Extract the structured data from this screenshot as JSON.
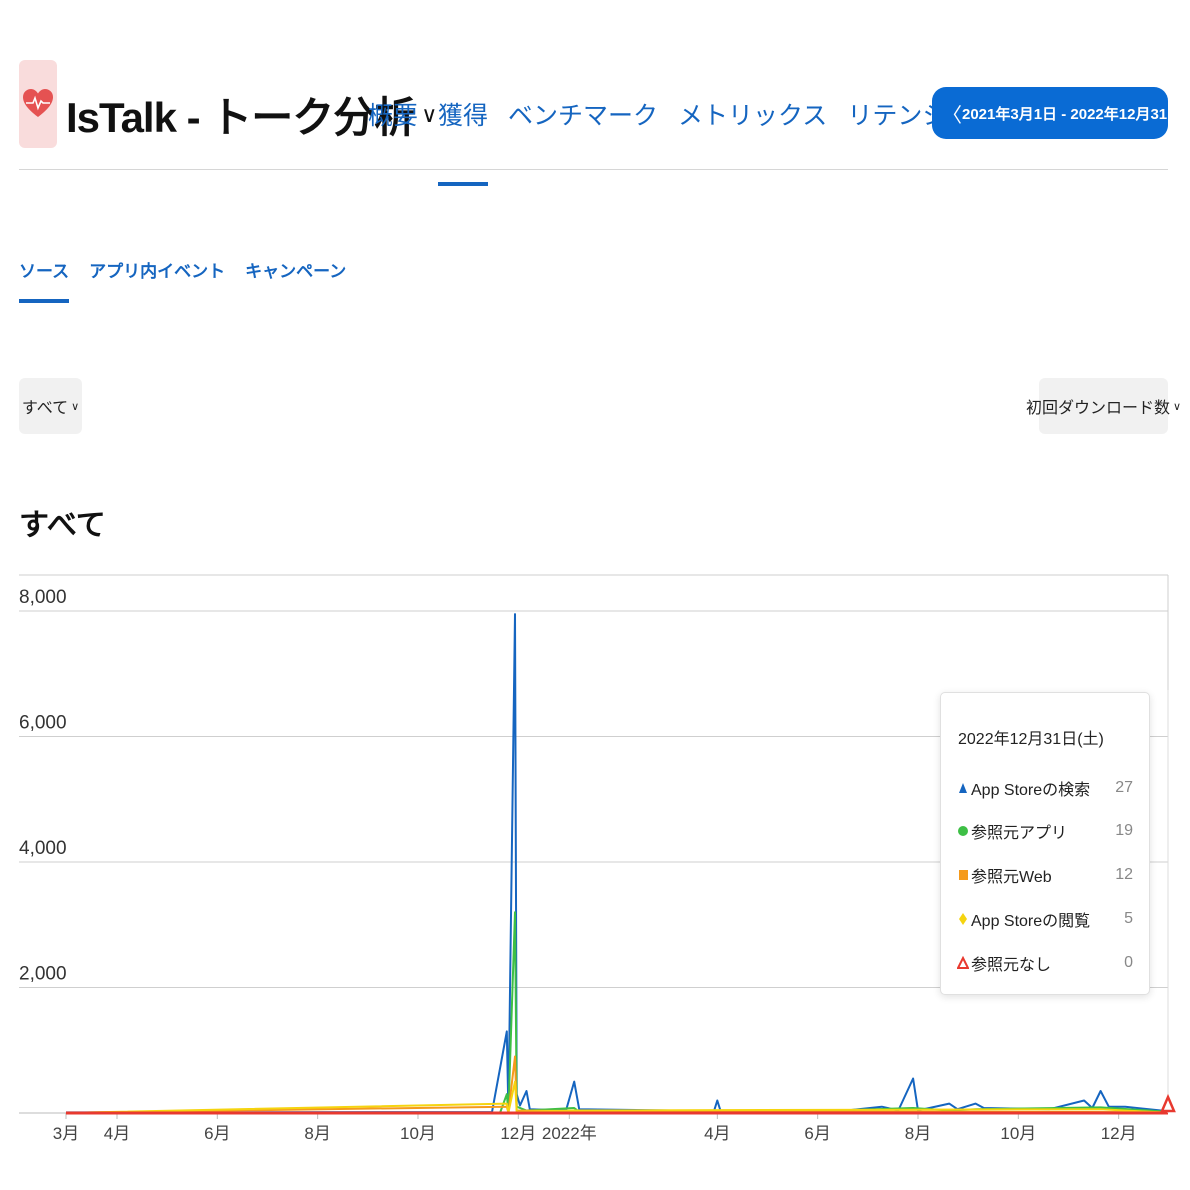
{
  "header": {
    "app_title": "IsTalk - トーク分析",
    "title_chevron": "∨",
    "tabs": [
      {
        "label": "概要",
        "active": false
      },
      {
        "label": "獲得",
        "active": true
      },
      {
        "label": "ベンチマーク",
        "active": false
      },
      {
        "label": "メトリックス",
        "active": false
      },
      {
        "label": "リテンション率",
        "active": false
      }
    ],
    "date_range": "2021年3月1日 - 2022年12月31日",
    "prev_arrow": "〈",
    "next_arrow": "〉"
  },
  "subtabs": [
    {
      "label": "ソース",
      "active": true
    },
    {
      "label": "アプリ内イベント",
      "active": false
    },
    {
      "label": "キャンペーン",
      "active": false
    }
  ],
  "filters": {
    "left_value": "すべて",
    "right_value": "初回ダウンロード数",
    "chevron": "∨"
  },
  "section_title": "すべて",
  "colors": {
    "accent": "#1565c0",
    "app_store_search": "#1565c0",
    "referral_app": "#3dbf45",
    "referral_web": "#f59a1b",
    "app_store_browse": "#f5d40f",
    "no_referral": "#e8392f"
  },
  "chart_data": {
    "type": "line",
    "ylim": [
      0,
      8000
    ],
    "yticks": [
      "8,000",
      "6,000",
      "4,000",
      "2,000"
    ],
    "y_tick_values": [
      8000,
      6000,
      4000,
      2000
    ],
    "x_tick_labels": [
      "3月",
      "4月",
      "6月",
      "8月",
      "10月",
      "12月",
      "2022年",
      "4月",
      "6月",
      "8月",
      "10月",
      "12月"
    ],
    "x_tick_dates": [
      "2021-03-01",
      "2021-04-01",
      "2021-06-01",
      "2021-08-01",
      "2021-10-01",
      "2021-12-01",
      "2022-01-01",
      "2022-04-01",
      "2022-06-01",
      "2022-08-01",
      "2022-10-01",
      "2022-12-01"
    ],
    "xlim": [
      "2021-03-01",
      "2022-12-31"
    ],
    "series": [
      {
        "name": "App Storeの検索",
        "color": "#1565c0",
        "points": [
          [
            "2021-03-01",
            10
          ],
          [
            "2021-11-15",
            15
          ],
          [
            "2021-11-24",
            1300
          ],
          [
            "2021-11-25",
            20
          ],
          [
            "2021-11-29",
            7950
          ],
          [
            "2021-11-30",
            300
          ],
          [
            "2021-12-02",
            120
          ],
          [
            "2021-12-06",
            350
          ],
          [
            "2021-12-08",
            60
          ],
          [
            "2021-12-30",
            40
          ],
          [
            "2022-01-04",
            500
          ],
          [
            "2022-01-07",
            60
          ],
          [
            "2022-03-30",
            30
          ],
          [
            "2022-04-01",
            200
          ],
          [
            "2022-04-03",
            30
          ],
          [
            "2022-06-15",
            30
          ],
          [
            "2022-07-10",
            100
          ],
          [
            "2022-07-20",
            40
          ],
          [
            "2022-07-29",
            550
          ],
          [
            "2022-08-01",
            40
          ],
          [
            "2022-08-20",
            150
          ],
          [
            "2022-08-25",
            60
          ],
          [
            "2022-09-05",
            150
          ],
          [
            "2022-09-10",
            80
          ],
          [
            "2022-10-20",
            60
          ],
          [
            "2022-11-10",
            200
          ],
          [
            "2022-11-15",
            80
          ],
          [
            "2022-11-20",
            350
          ],
          [
            "2022-11-25",
            100
          ],
          [
            "2022-12-05",
            100
          ],
          [
            "2022-12-31",
            27
          ]
        ]
      },
      {
        "name": "参照元アプリ",
        "color": "#3dbf45",
        "points": [
          [
            "2021-03-01",
            5
          ],
          [
            "2021-11-20",
            10
          ],
          [
            "2021-11-24",
            300
          ],
          [
            "2021-11-25",
            15
          ],
          [
            "2021-11-29",
            3200
          ],
          [
            "2021-11-30",
            100
          ],
          [
            "2021-12-06",
            40
          ],
          [
            "2022-01-04",
            80
          ],
          [
            "2022-01-07",
            20
          ],
          [
            "2022-06-01",
            30
          ],
          [
            "2022-07-29",
            80
          ],
          [
            "2022-08-20",
            40
          ],
          [
            "2022-09-05",
            60
          ],
          [
            "2022-11-20",
            90
          ],
          [
            "2022-12-31",
            19
          ]
        ]
      },
      {
        "name": "参照元Web",
        "color": "#f59a1b",
        "points": [
          [
            "2021-03-01",
            3
          ],
          [
            "2021-11-24",
            100
          ],
          [
            "2021-11-25",
            10
          ],
          [
            "2021-11-29",
            900
          ],
          [
            "2021-11-30",
            40
          ],
          [
            "2022-01-04",
            30
          ],
          [
            "2022-12-31",
            12
          ]
        ]
      },
      {
        "name": "App Storeの閲覧",
        "color": "#f5d40f",
        "points": [
          [
            "2021-03-01",
            2
          ],
          [
            "2021-11-24",
            150
          ],
          [
            "2021-11-25",
            5
          ],
          [
            "2021-11-29",
            500
          ],
          [
            "2021-11-30",
            20
          ],
          [
            "2022-01-04",
            40
          ],
          [
            "2022-11-20",
            60
          ],
          [
            "2022-12-31",
            5
          ]
        ]
      },
      {
        "name": "参照元なし",
        "color": "#e8392f",
        "points": [
          [
            "2021-03-01",
            0
          ],
          [
            "2022-12-31",
            0
          ]
        ]
      }
    ],
    "tooltip": {
      "date": "2022年12月31日(土)",
      "rows": [
        {
          "label": "App Storeの検索",
          "value": "27",
          "marker": "triangle",
          "color": "#1565c0"
        },
        {
          "label": "参照元アプリ",
          "value": "19",
          "marker": "circle",
          "color": "#3dbf45"
        },
        {
          "label": "参照元Web",
          "value": "12",
          "marker": "square",
          "color": "#f59a1b"
        },
        {
          "label": "App Storeの閲覧",
          "value": "5",
          "marker": "diamond",
          "color": "#f5d40f"
        },
        {
          "label": "参照元なし",
          "value": "0",
          "marker": "triangle-outline",
          "color": "#e8392f"
        }
      ]
    }
  }
}
